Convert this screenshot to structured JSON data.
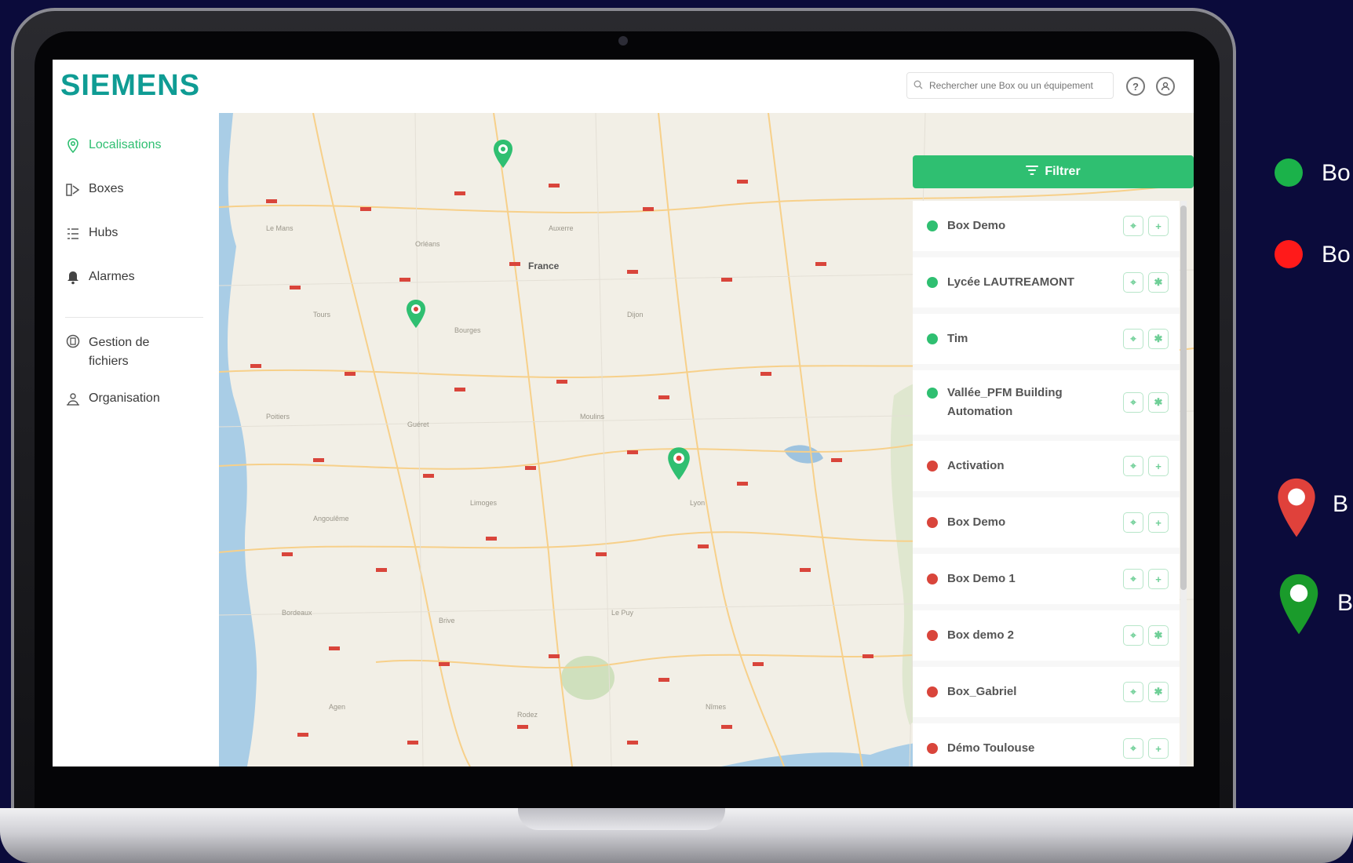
{
  "brand": {
    "logo": "SIEMENS",
    "accent": "#2fbf71",
    "logo_color": "#0f9c94"
  },
  "sidebar": {
    "items": [
      {
        "label": "Localisations",
        "icon": "location-pin-icon",
        "active": true
      },
      {
        "label": "Boxes",
        "icon": "boxes-icon"
      },
      {
        "label": "Hubs",
        "icon": "hubs-list-icon"
      },
      {
        "label": "Alarmes",
        "icon": "bell-icon"
      }
    ],
    "items2": [
      {
        "label": "Gestion de fichiers",
        "icon": "file-management-icon"
      },
      {
        "label": "Organisation",
        "icon": "organisation-icon"
      }
    ]
  },
  "topbar": {
    "search_placeholder": "Rechercher une Box ou un équipement",
    "help_icon": "help-icon",
    "user_icon": "user-icon"
  },
  "map": {
    "country_label": "France"
  },
  "filter": {
    "label": "Filtrer",
    "icon": "filter-icon"
  },
  "boxes": [
    {
      "name": "Box Demo",
      "status": "online"
    },
    {
      "name": "Lycée LAUTREAMONT",
      "status": "online"
    },
    {
      "name": "Tim",
      "status": "online"
    },
    {
      "name": "Vallée_PFM Building Automation",
      "status": "online"
    },
    {
      "name": "Activation",
      "status": "offline"
    },
    {
      "name": "Box Demo",
      "status": "offline"
    },
    {
      "name": "Box Demo 1",
      "status": "offline"
    },
    {
      "name": "Box demo 2",
      "status": "offline"
    },
    {
      "name": "Box_Gabriel",
      "status": "offline"
    },
    {
      "name": "Démo Toulouse",
      "status": "offline"
    }
  ],
  "status_colors": {
    "online": "#2fbf71",
    "offline": "#d9453b"
  },
  "legend": {
    "green_dot": "Bo",
    "red_dot": "Bo",
    "red_pin": "B",
    "green_pin": "B"
  }
}
